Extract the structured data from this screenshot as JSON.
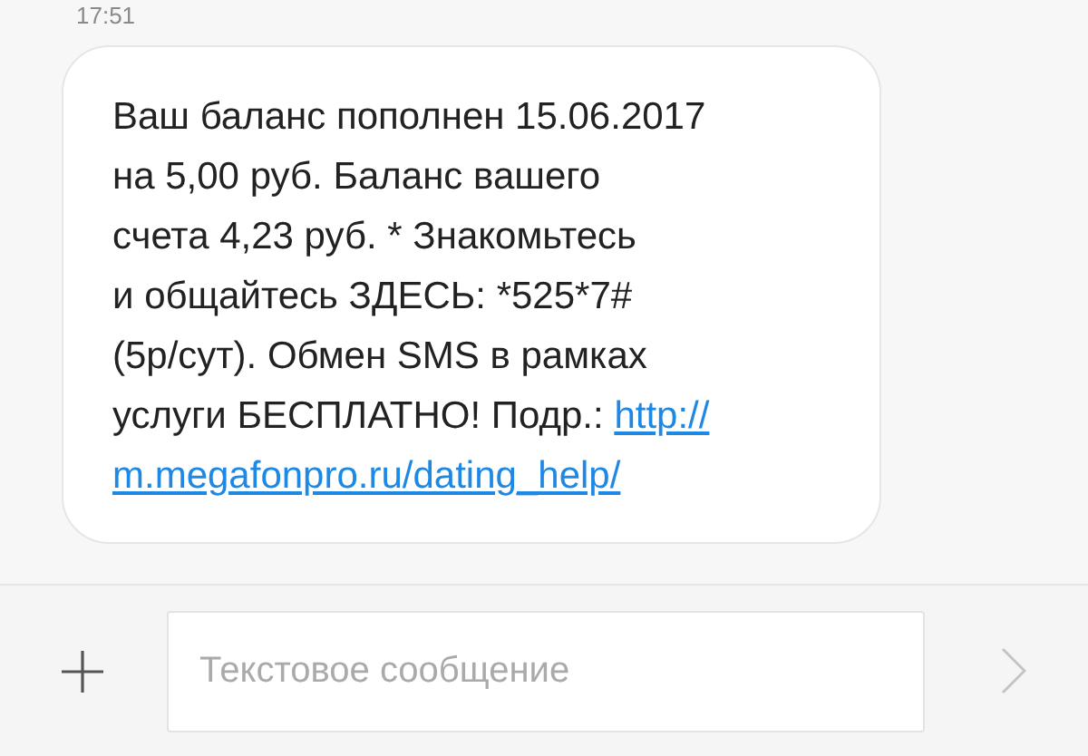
{
  "message": {
    "time": "17:51",
    "lines": [
      [
        {
          "kind": "text",
          "text": "Ваш баланс пополнен 15.06.2017"
        }
      ],
      [
        {
          "kind": "text",
          "text": "на 5,00 руб. Баланс вашего"
        }
      ],
      [
        {
          "kind": "text",
          "text": "счета 4,23 руб. * Знакомьтесь"
        }
      ],
      [
        {
          "kind": "text",
          "text": "и общайтесь ЗДЕСЬ: *525*7#"
        }
      ],
      [
        {
          "kind": "text",
          "text": "(5р/сут). Обмен SMS в рамках"
        }
      ],
      [
        {
          "kind": "text",
          "text": "услуги БЕСПЛАТНО! Подр.: "
        },
        {
          "kind": "link",
          "text": "http://"
        }
      ],
      [
        {
          "kind": "link",
          "text": "m.megafonpro.ru/dating_help/"
        }
      ]
    ]
  },
  "composer": {
    "placeholder": "Текстовое сообщение"
  }
}
